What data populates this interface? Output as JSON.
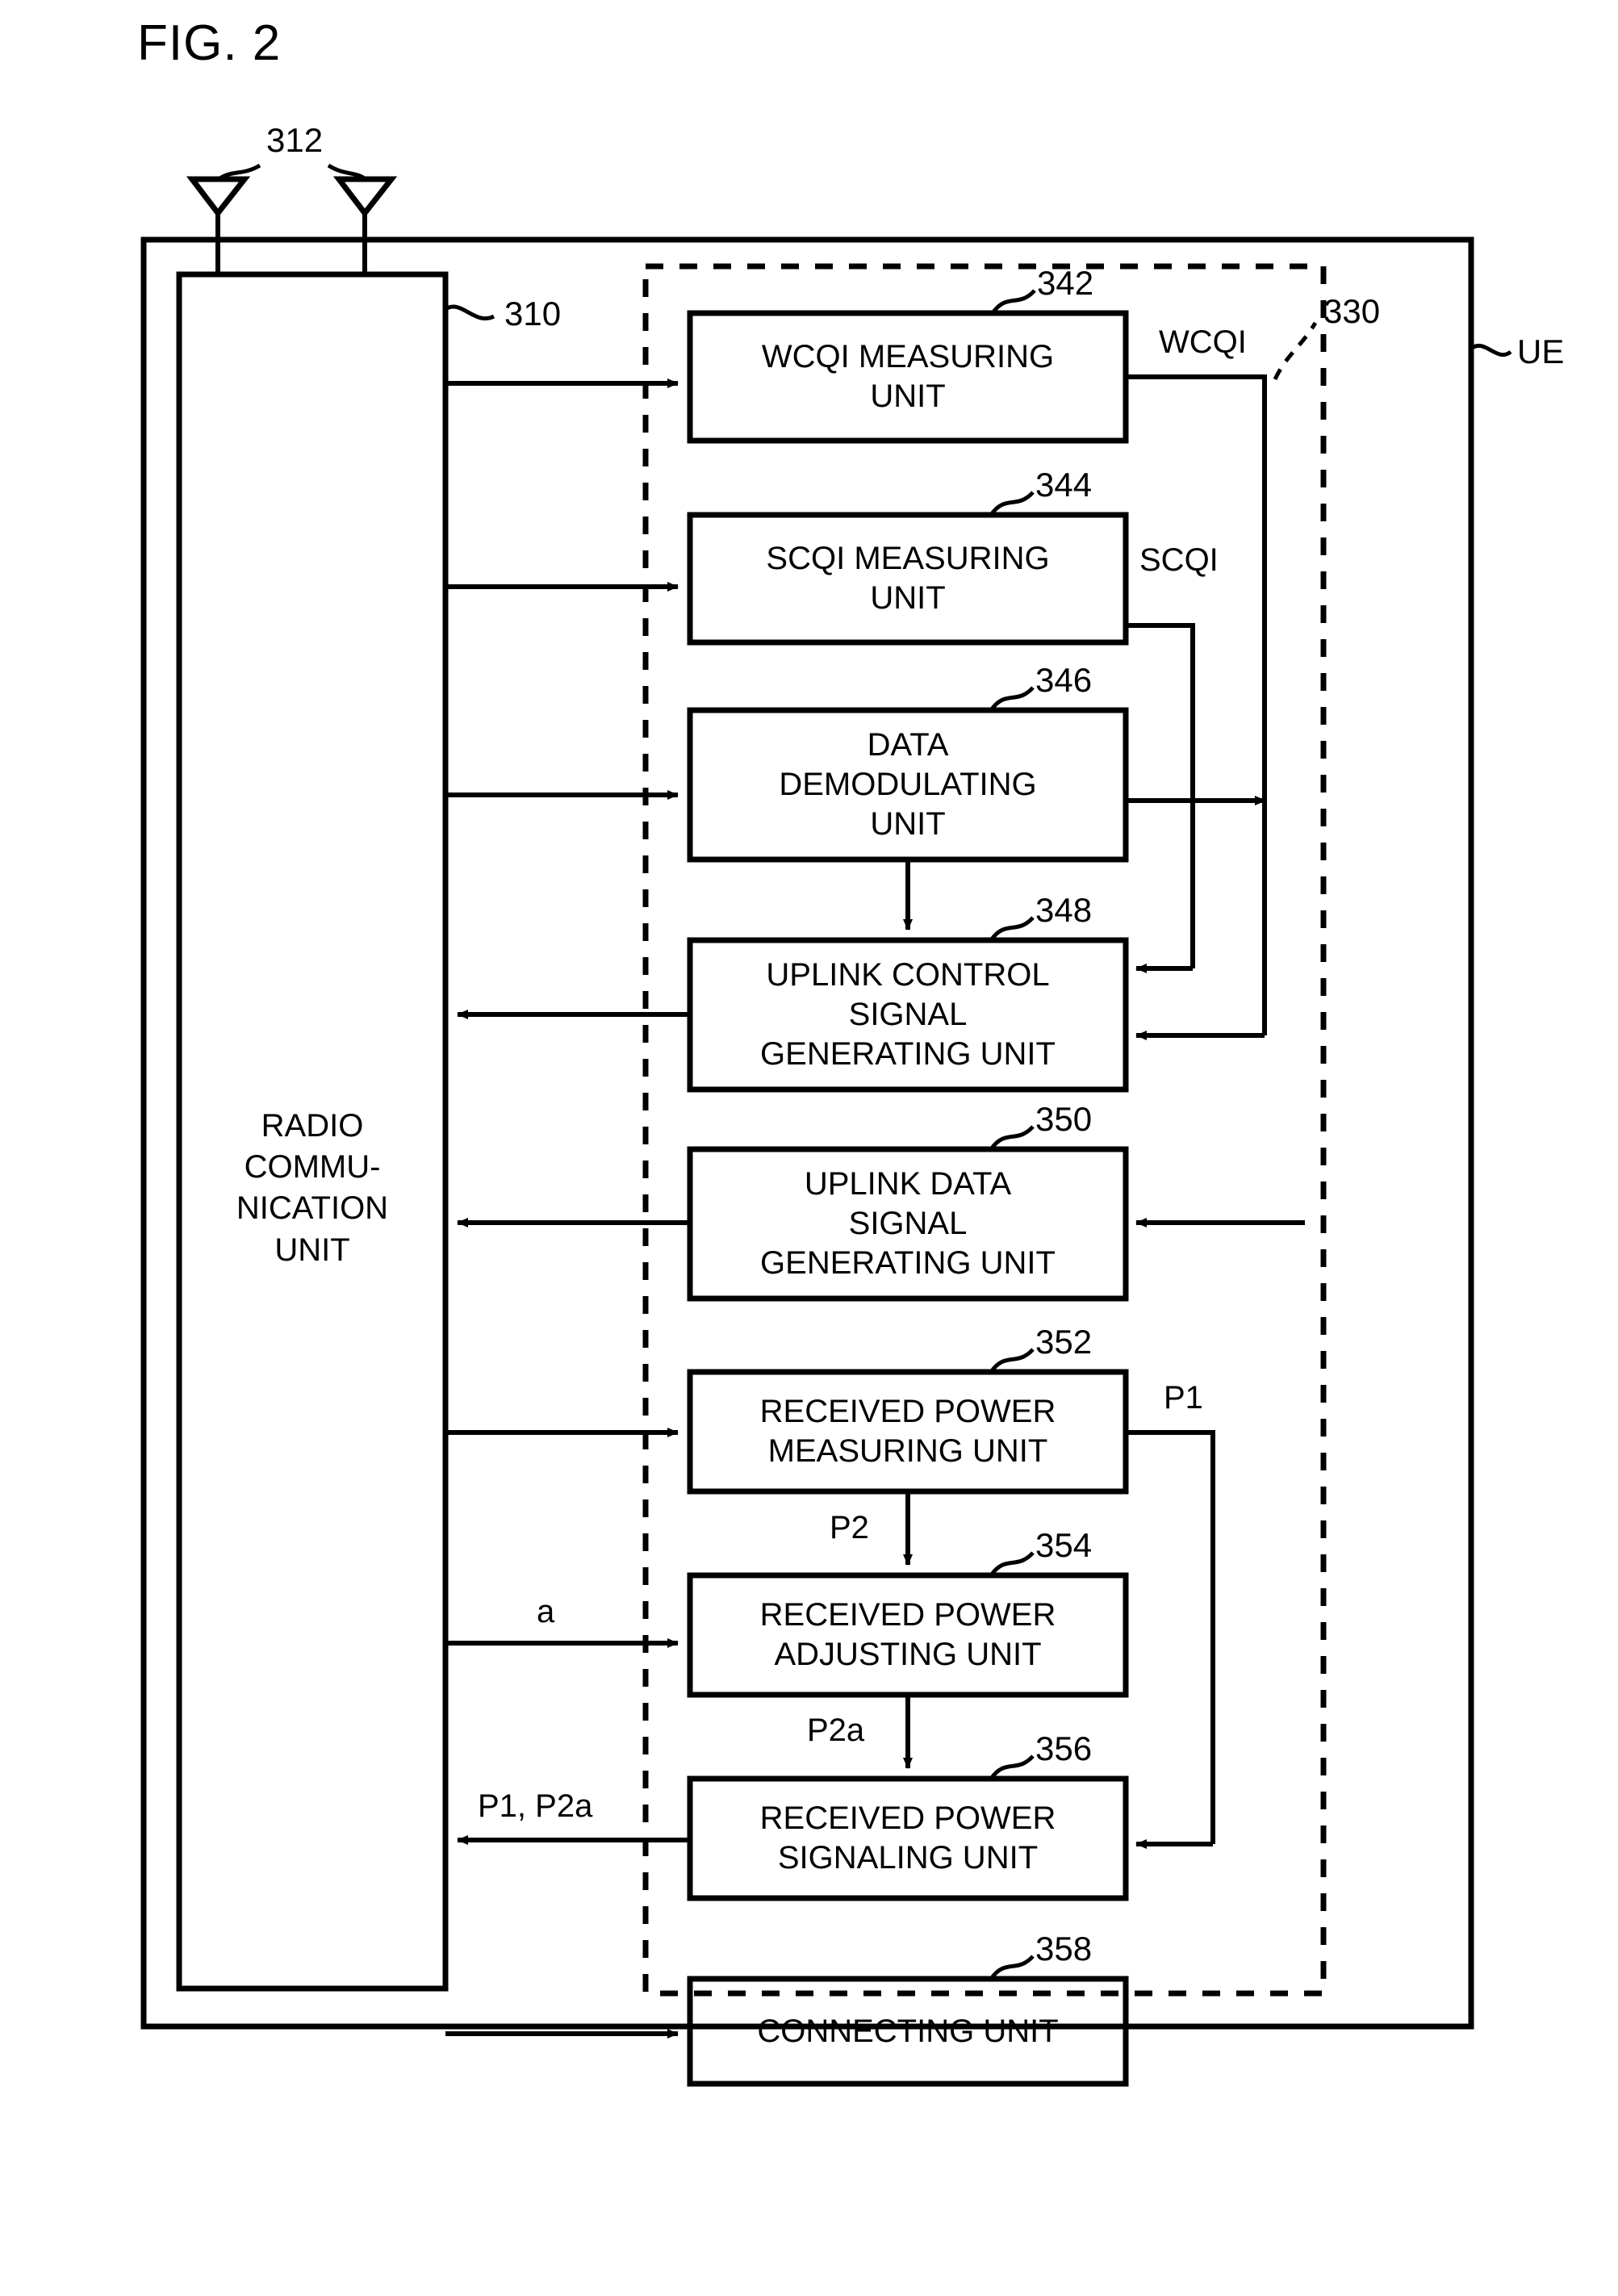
{
  "figure": {
    "title": "FIG. 2"
  },
  "reference_numerals": {
    "antenna": "312",
    "radio_communication_unit": "310",
    "wcqi_measuring_unit": "342",
    "scqi_measuring_unit": "344",
    "data_demodulating_unit": "346",
    "uplink_control_signal_generating_unit": "348",
    "uplink_data_signal_generating_unit": "350",
    "received_power_measuring_unit": "352",
    "received_power_adjusting_unit": "354",
    "received_power_signaling_unit": "356",
    "connecting_unit": "358",
    "inner_dashed_group": "330",
    "device": "UE"
  },
  "blocks": [
    {
      "id": "wcqi",
      "label": "WCQI MEASURING\nUNIT",
      "ref": "342"
    },
    {
      "id": "scqi",
      "label": "SCQI MEASURING\nUNIT",
      "ref": "344"
    },
    {
      "id": "datademod",
      "label": "DATA\nDEMODULATING\nUNIT",
      "ref": "346"
    },
    {
      "id": "ulctrl",
      "label": "UPLINK CONTROL\nSIGNAL\nGENERATING UNIT",
      "ref": "348"
    },
    {
      "id": "uldata",
      "label": "UPLINK DATA\nSIGNAL\nGENERATING UNIT",
      "ref": "350"
    },
    {
      "id": "rpmeas",
      "label": "RECEIVED POWER\nMEASURING UNIT",
      "ref": "352"
    },
    {
      "id": "rpadj",
      "label": "RECEIVED POWER\nADJUSTING UNIT",
      "ref": "354"
    },
    {
      "id": "rpsig",
      "label": "RECEIVED POWER\nSIGNALING UNIT",
      "ref": "356"
    },
    {
      "id": "connect",
      "label": "CONNECTING UNIT",
      "ref": "358"
    }
  ],
  "radio_communication_unit": {
    "label": "RADIO\nCOMMU-\nNICATION\nUNIT",
    "ref": "310"
  },
  "signal_labels": {
    "wcqi": "WCQI",
    "scqi": "SCQI",
    "p1": "P1",
    "p2": "P2",
    "p2a": "P2a",
    "a": "a",
    "p1_p2a": "P1, P2a"
  },
  "outer_labels": {
    "ue": "UE",
    "group": "330",
    "antenna": "312",
    "rcu": "310"
  },
  "colors": {
    "line": "#000000",
    "background": "#ffffff"
  }
}
